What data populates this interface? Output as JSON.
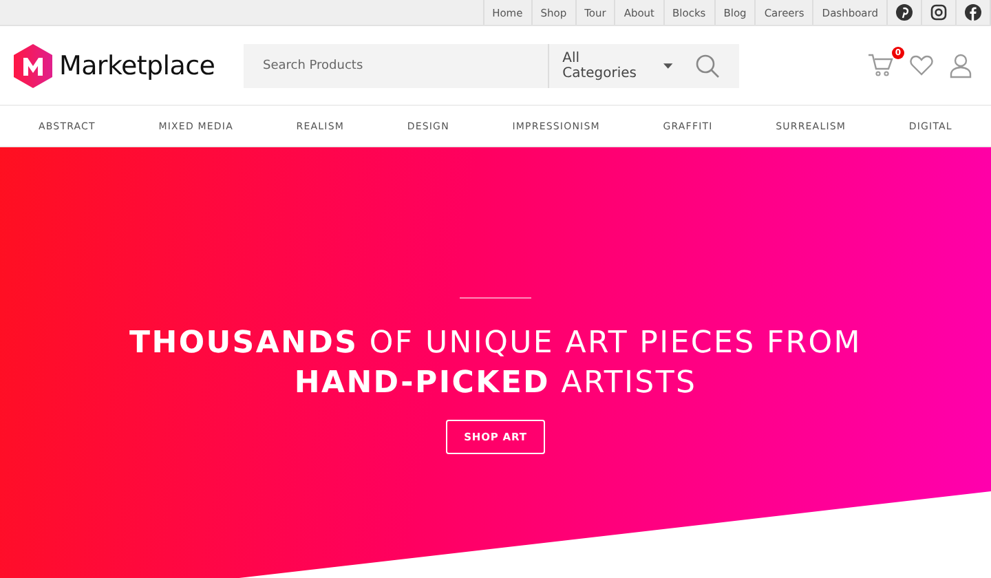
{
  "top_links": [
    "Home",
    "Shop",
    "Tour",
    "About",
    "Blocks",
    "Blog",
    "Careers",
    "Dashboard"
  ],
  "logo": {
    "text": "Marketplace"
  },
  "search": {
    "placeholder": "Search Products",
    "category": "All Categories"
  },
  "cart": {
    "count": "0"
  },
  "nav": [
    "ABSTRACT",
    "MIXED MEDIA",
    "REALISM",
    "DESIGN",
    "IMPRESSIONISM",
    "GRAFFITI",
    "SURREALISM",
    "DIGITAL"
  ],
  "hero": {
    "headline": "**THOUSANDS** OF UNIQUE ART PIECES FROM **HAND-PICKED** ARTISTS",
    "button": "SHOP ART"
  }
}
